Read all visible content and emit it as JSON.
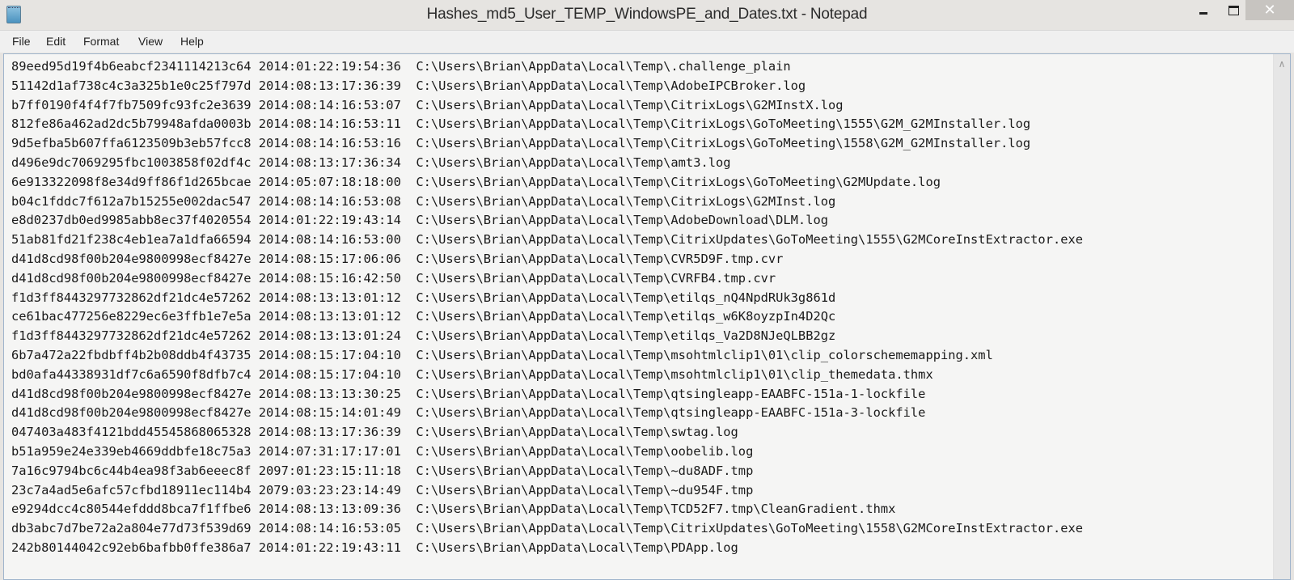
{
  "window": {
    "title": "Hashes_md5_User_TEMP_WindowsPE_and_Dates.txt - Notepad",
    "controls": {
      "minimize": "minimize-icon",
      "maximize": "maximize-icon",
      "close_glyph": "✕"
    }
  },
  "menu": [
    "File",
    "Edit",
    "Format",
    "View",
    "Help"
  ],
  "scrollbar": {
    "up_glyph": "∧"
  },
  "lines": [
    "89eed95d19f4b6eabcf2341114213c64 2014:01:22:19:54:36  C:\\Users\\Brian\\AppData\\Local\\Temp\\.challenge_plain",
    "51142d1af738c4c3a325b1e0c25f797d 2014:08:13:17:36:39  C:\\Users\\Brian\\AppData\\Local\\Temp\\AdobeIPCBroker.log",
    "b7ff0190f4f4f7fb7509fc93fc2e3639 2014:08:14:16:53:07  C:\\Users\\Brian\\AppData\\Local\\Temp\\CitrixLogs\\G2MInstX.log",
    "812fe86a462ad2dc5b79948afda0003b 2014:08:14:16:53:11  C:\\Users\\Brian\\AppData\\Local\\Temp\\CitrixLogs\\GoToMeeting\\1555\\G2M_G2MInstaller.log",
    "9d5efba5b607ffa6123509b3eb57fcc8 2014:08:14:16:53:16  C:\\Users\\Brian\\AppData\\Local\\Temp\\CitrixLogs\\GoToMeeting\\1558\\G2M_G2MInstaller.log",
    "d496e9dc7069295fbc1003858f02df4c 2014:08:13:17:36:34  C:\\Users\\Brian\\AppData\\Local\\Temp\\amt3.log",
    "6e913322098f8e34d9ff86f1d265bcae 2014:05:07:18:18:00  C:\\Users\\Brian\\AppData\\Local\\Temp\\CitrixLogs\\GoToMeeting\\G2MUpdate.log",
    "b04c1fddc7f612a7b15255e002dac547 2014:08:14:16:53:08  C:\\Users\\Brian\\AppData\\Local\\Temp\\CitrixLogs\\G2MInst.log",
    "e8d0237db0ed9985abb8ec37f4020554 2014:01:22:19:43:14  C:\\Users\\Brian\\AppData\\Local\\Temp\\AdobeDownload\\DLM.log",
    "51ab81fd21f238c4eb1ea7a1dfa66594 2014:08:14:16:53:00  C:\\Users\\Brian\\AppData\\Local\\Temp\\CitrixUpdates\\GoToMeeting\\1555\\G2MCoreInstExtractor.exe",
    "d41d8cd98f00b204e9800998ecf8427e 2014:08:15:17:06:06  C:\\Users\\Brian\\AppData\\Local\\Temp\\CVR5D9F.tmp.cvr",
    "d41d8cd98f00b204e9800998ecf8427e 2014:08:15:16:42:50  C:\\Users\\Brian\\AppData\\Local\\Temp\\CVRFB4.tmp.cvr",
    "f1d3ff8443297732862df21dc4e57262 2014:08:13:13:01:12  C:\\Users\\Brian\\AppData\\Local\\Temp\\etilqs_nQ4NpdRUk3g861d",
    "ce61bac477256e8229ec6e3ffb1e7e5a 2014:08:13:13:01:12  C:\\Users\\Brian\\AppData\\Local\\Temp\\etilqs_w6K8oyzpIn4D2Qc",
    "f1d3ff8443297732862df21dc4e57262 2014:08:13:13:01:24  C:\\Users\\Brian\\AppData\\Local\\Temp\\etilqs_Va2D8NJeQLBB2gz",
    "6b7a472a22fbdbff4b2b08ddb4f43735 2014:08:15:17:04:10  C:\\Users\\Brian\\AppData\\Local\\Temp\\msohtmlclip1\\01\\clip_colorschememapping.xml",
    "bd0afa44338931df7c6a6590f8dfb7c4 2014:08:15:17:04:10  C:\\Users\\Brian\\AppData\\Local\\Temp\\msohtmlclip1\\01\\clip_themedata.thmx",
    "d41d8cd98f00b204e9800998ecf8427e 2014:08:13:13:30:25  C:\\Users\\Brian\\AppData\\Local\\Temp\\qtsingleapp-EAABFC-151a-1-lockfile",
    "d41d8cd98f00b204e9800998ecf8427e 2014:08:15:14:01:49  C:\\Users\\Brian\\AppData\\Local\\Temp\\qtsingleapp-EAABFC-151a-3-lockfile",
    "047403a483f4121bdd45545868065328 2014:08:13:17:36:39  C:\\Users\\Brian\\AppData\\Local\\Temp\\swtag.log",
    "b51a959e24e339eb4669ddbfe18c75a3 2014:07:31:17:17:01  C:\\Users\\Brian\\AppData\\Local\\Temp\\oobelib.log",
    "7a16c9794bc6c44b4ea98f3ab6eeec8f 2097:01:23:15:11:18  C:\\Users\\Brian\\AppData\\Local\\Temp\\~du8ADF.tmp",
    "23c7a4ad5e6afc57cfbd18911ec114b4 2079:03:23:23:14:49  C:\\Users\\Brian\\AppData\\Local\\Temp\\~du954F.tmp",
    "e9294dcc4c80544efddd8bca7f1ffbe6 2014:08:13:13:09:36  C:\\Users\\Brian\\AppData\\Local\\Temp\\TCD52F7.tmp\\CleanGradient.thmx",
    "db3abc7d7be72a2a804e77d73f539d69 2014:08:14:16:53:05  C:\\Users\\Brian\\AppData\\Local\\Temp\\CitrixUpdates\\GoToMeeting\\1558\\G2MCoreInstExtractor.exe",
    "242b80144042c92eb6bafbb0ffe386a7 2014:01:22:19:43:11  C:\\Users\\Brian\\AppData\\Local\\Temp\\PDApp.log"
  ]
}
